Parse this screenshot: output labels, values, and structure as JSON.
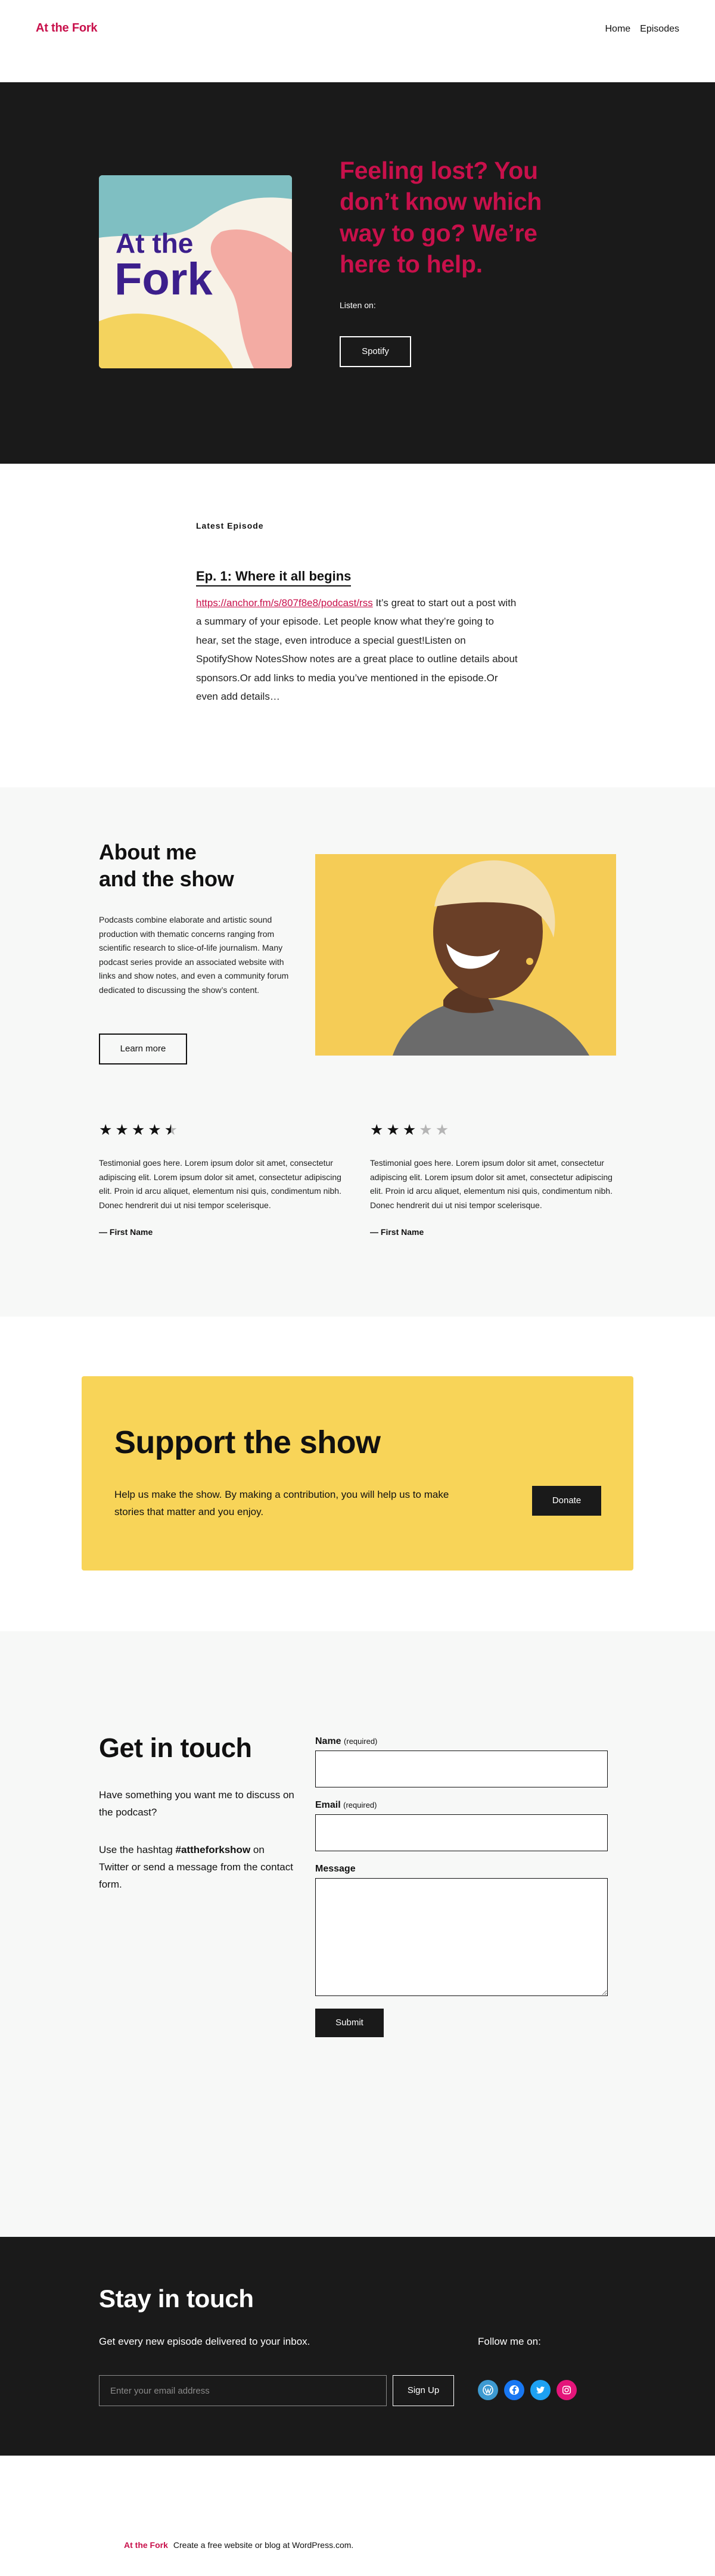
{
  "header": {
    "site_title": "At the Fork",
    "nav": [
      "Home",
      "Episodes"
    ]
  },
  "hero": {
    "cover_text_line1": "At the",
    "cover_text_line2": "Fork",
    "headline": "Feeling lost? You don’t know which way to go? We’re here to help.",
    "listen_on": "Listen on:",
    "spotify_label": "Spotify"
  },
  "latest": {
    "label": "Latest Episode",
    "episode_title": "Ep. 1: Where it all begins",
    "episode_link": "https://anchor.fm/s/807f8e8/podcast/rss",
    "episode_body": "It’s great to start out a post with a summary of your episode. Let people know what they’re going to hear, set the stage, even introduce a special guest!Listen on SpotifyShow NotesShow notes are a great place to outline details about sponsors.Or add links to media you’ve mentioned in the episode.Or even add details…"
  },
  "about": {
    "title_line1": "About me",
    "title_line2": "and the show",
    "text": "Podcasts combine elaborate and artistic sound production with thematic concerns ranging from scientific research to slice-of-life journalism. Many podcast series provide an associated website with links and show notes, and even a community forum dedicated to discussing the show’s content.",
    "learn_more": "Learn more",
    "testimonials": [
      {
        "rating": 4.5,
        "text": "Testimonial goes here. Lorem ipsum dolor sit amet, consectetur adipiscing elit. Lorem ipsum dolor sit amet, consectetur adipiscing elit. Proin id arcu aliquet, elementum nisi quis, condimentum nibh. Donec hendrerit dui ut nisi tempor scelerisque.",
        "author": "— First Name"
      },
      {
        "rating": 3,
        "text": "Testimonial goes here. Lorem ipsum dolor sit amet, consectetur adipiscing elit. Lorem ipsum dolor sit amet, consectetur adipiscing elit. Proin id arcu aliquet, elementum nisi quis, condimentum nibh. Donec hendrerit dui ut nisi tempor scelerisque.",
        "author": "— First Name"
      }
    ]
  },
  "support": {
    "title": "Support the show",
    "text": "Help us make the show. By making a contribution, you will help us to make stories that matter and you enjoy.",
    "donate": "Donate"
  },
  "contact": {
    "title": "Get in touch",
    "p1": "Have something you want me to discuss on the podcast?",
    "p2_before": "Use the hashtag ",
    "p2_hashtag": "#attheforkshow",
    "p2_after": " on Twitter or send a message from the contact form.",
    "name_label": "Name",
    "email_label": "Email",
    "required": "(required)",
    "message_label": "Message",
    "submit": "Submit"
  },
  "stay": {
    "title": "Stay in touch",
    "subtitle": "Get every new episode delivered to your inbox.",
    "email_placeholder": "Enter your email address",
    "signup": "Sign Up",
    "follow": "Follow me on:",
    "socials": [
      {
        "name": "wordpress-icon",
        "color": "#3d9ad1"
      },
      {
        "name": "facebook-icon",
        "color": "#1877f2"
      },
      {
        "name": "twitter-icon",
        "color": "#1da1f2"
      },
      {
        "name": "instagram-icon",
        "color": "#e4157a"
      }
    ]
  },
  "footer": {
    "brand": "At the Fork",
    "text": "Create a free website or blog at WordPress.com."
  },
  "colors": {
    "accent": "#c8104b",
    "dark": "#1a1a1a",
    "support_yellow": "#f8d458",
    "light_bg": "#f7f8f7"
  }
}
